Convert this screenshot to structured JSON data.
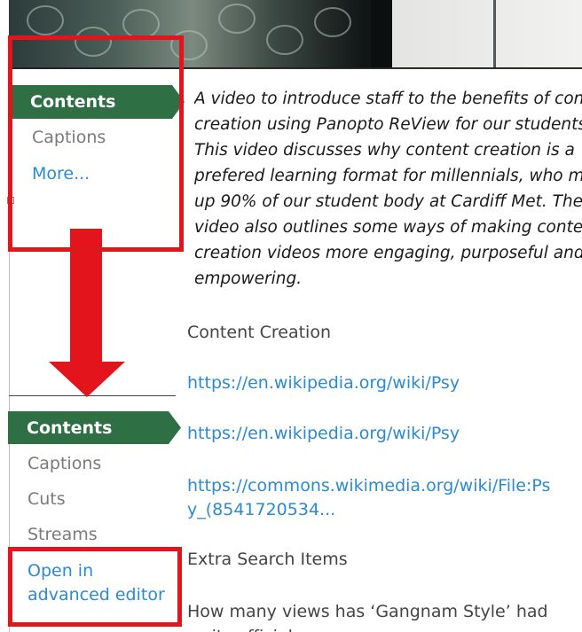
{
  "panel_top": {
    "tabs": [
      {
        "label": "Contents",
        "state": "active"
      },
      {
        "label": "Captions",
        "state": "inactive"
      },
      {
        "label": "More...",
        "state": "link"
      }
    ]
  },
  "panel_bottom": {
    "tabs": [
      {
        "label": "Contents",
        "state": "active"
      },
      {
        "label": "Captions",
        "state": "inactive"
      },
      {
        "label": "Cuts",
        "state": "inactive"
      },
      {
        "label": "Streams",
        "state": "inactive"
      },
      {
        "label": "Open in advanced editor",
        "state": "link"
      }
    ]
  },
  "description": "A video to introduce staff to the benefits of cont\ncreation using Panopto ReView for our students\nThis video discusses why content creation is a\nprefered learning format for millennials, who m\nup 90% of our student body at Cardiff Met. The\nvideo also outlines some ways of making conter\ncreation videos more engaging, purposeful and\nempowering.",
  "contents": {
    "heading": "Content Creation",
    "links": [
      "https://en.wikipedia.org/wiki/Psy",
      "https://en.wikipedia.org/wiki/Psy",
      "https://commons.wikimedia.org/wiki/File:Ps\ny_(8541720534..."
    ],
    "extra_heading": "Extra Search Items",
    "question": "How many views has ‘Gangnam Style’ had\nso its official"
  },
  "colors": {
    "active_tab": "#2e7043",
    "link": "#2b8ad0",
    "annotation_red": "#e3141b"
  }
}
